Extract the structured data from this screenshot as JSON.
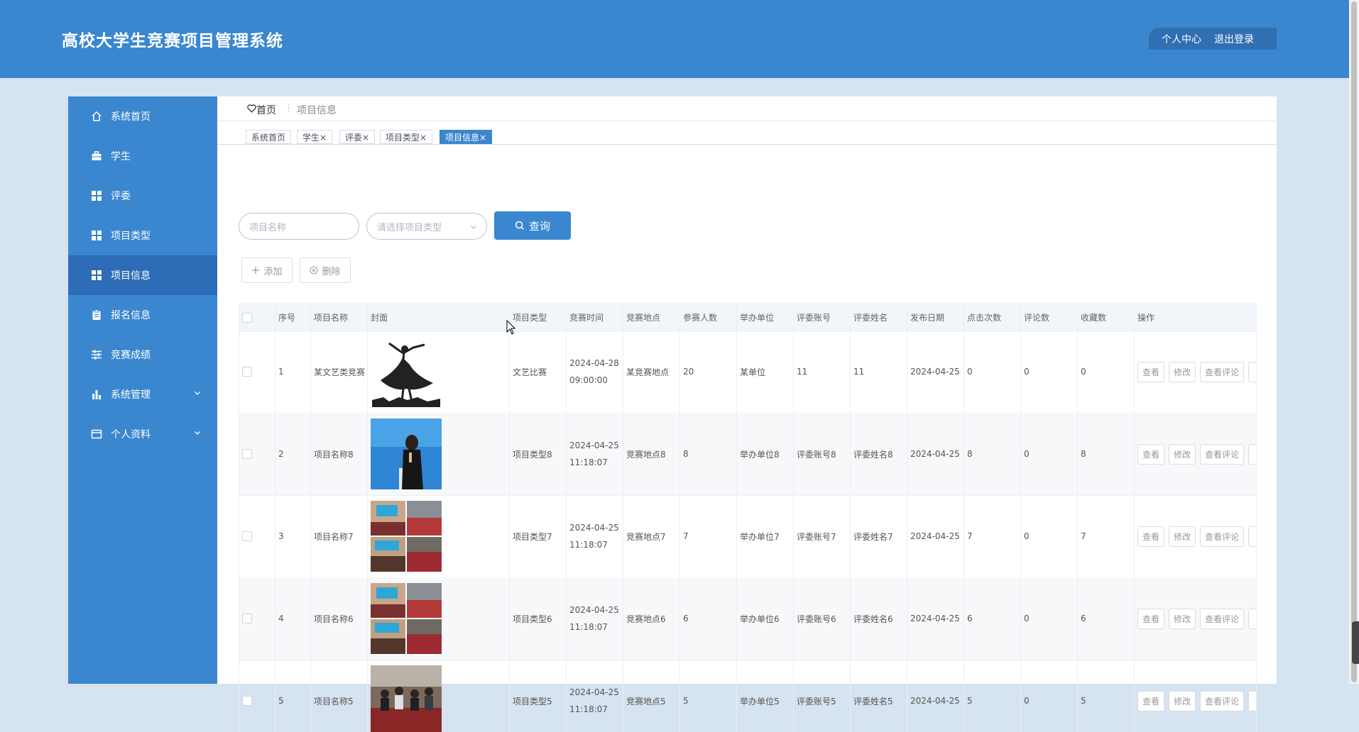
{
  "header": {
    "title": "高校大学生竞赛项目管理系统",
    "personal_center": "个人中心",
    "logout": "退出登录"
  },
  "sidebar": {
    "items": [
      {
        "label": "系统首页",
        "icon": "home-icon"
      },
      {
        "label": "学生",
        "icon": "briefcase-icon"
      },
      {
        "label": "评委",
        "icon": "grid-icon"
      },
      {
        "label": "项目类型",
        "icon": "grid-icon"
      },
      {
        "label": "项目信息",
        "icon": "grid-icon",
        "active": true
      },
      {
        "label": "报名信息",
        "icon": "clipboard-icon"
      },
      {
        "label": "竞赛成绩",
        "icon": "sliders-icon"
      },
      {
        "label": "系统管理",
        "icon": "bar-chart-icon",
        "expandable": true
      },
      {
        "label": "个人资料",
        "icon": "card-icon",
        "expandable": true
      }
    ]
  },
  "breadcrumb": {
    "home": "首页",
    "separator": "⋮",
    "current": "项目信息"
  },
  "tabs": [
    {
      "label": "系统首页",
      "closable": false
    },
    {
      "label": "学生",
      "closable": true
    },
    {
      "label": "评委",
      "closable": true
    },
    {
      "label": "项目类型",
      "closable": true
    },
    {
      "label": "项目信息",
      "closable": true,
      "active": true
    }
  ],
  "tab_close_glyph": "×",
  "search": {
    "name_placeholder": "项目名称",
    "type_placeholder": "请选择项目类型",
    "query_label": "查询"
  },
  "actions": {
    "add_label": "添加",
    "delete_label": "删除"
  },
  "table": {
    "columns": [
      "序号",
      "项目名称",
      "封面",
      "项目类型",
      "竞赛时间",
      "竞赛地点",
      "参赛人数",
      "举办单位",
      "评委账号",
      "评委姓名",
      "发布日期",
      "点击次数",
      "评论数",
      "收藏数",
      "操作"
    ],
    "rows": [
      {
        "no": "1",
        "name": "某文艺类竞赛",
        "cover": "dancer-silhouette",
        "type": "文艺比赛",
        "time_date": "2024-04-28",
        "time_clock": "09:00:00",
        "place": "某竞赛地点",
        "count": "20",
        "org": "某单位",
        "judge_account": "11",
        "judge_name": "11",
        "publish": "2024-04-25",
        "clicks": "0",
        "comments": "0",
        "favorites": "0"
      },
      {
        "no": "2",
        "name": "项目名称8",
        "cover": "speaker-photo",
        "type": "项目类型8",
        "time_date": "2024-04-25",
        "time_clock": "11:18:07",
        "place": "竞赛地点8",
        "count": "8",
        "org": "举办单位8",
        "judge_account": "评委账号8",
        "judge_name": "评委姓名8",
        "publish": "2024-04-25",
        "clicks": "8",
        "comments": "0",
        "favorites": "8"
      },
      {
        "no": "3",
        "name": "项目名称7",
        "cover": "collage-photo",
        "type": "项目类型7",
        "time_date": "2024-04-25",
        "time_clock": "11:18:07",
        "place": "竞赛地点7",
        "count": "7",
        "org": "举办单位7",
        "judge_account": "评委账号7",
        "judge_name": "评委姓名7",
        "publish": "2024-04-25",
        "clicks": "7",
        "comments": "0",
        "favorites": "7"
      },
      {
        "no": "4",
        "name": "项目名称6",
        "cover": "collage-photo",
        "type": "项目类型6",
        "time_date": "2024-04-25",
        "time_clock": "11:18:07",
        "place": "竞赛地点6",
        "count": "6",
        "org": "举办单位6",
        "judge_account": "评委账号6",
        "judge_name": "评委姓名6",
        "publish": "2024-04-25",
        "clicks": "6",
        "comments": "0",
        "favorites": "6"
      },
      {
        "no": "5",
        "name": "项目名称5",
        "cover": "crowd-photo",
        "type": "项目类型5",
        "time_date": "2024-04-25",
        "time_clock": "11:18:07",
        "place": "竞赛地点5",
        "count": "5",
        "org": "举办单位5",
        "judge_account": "评委账号5",
        "judge_name": "评委姓名5",
        "publish": "2024-04-25",
        "clicks": "5",
        "comments": "0",
        "favorites": "5"
      }
    ],
    "row_actions": [
      "查看",
      "修改",
      "查看评论"
    ]
  },
  "colors": {
    "primary": "#3a87cf",
    "sidebar_active": "#2d6cb6",
    "page_bg": "#d6e3f0"
  }
}
